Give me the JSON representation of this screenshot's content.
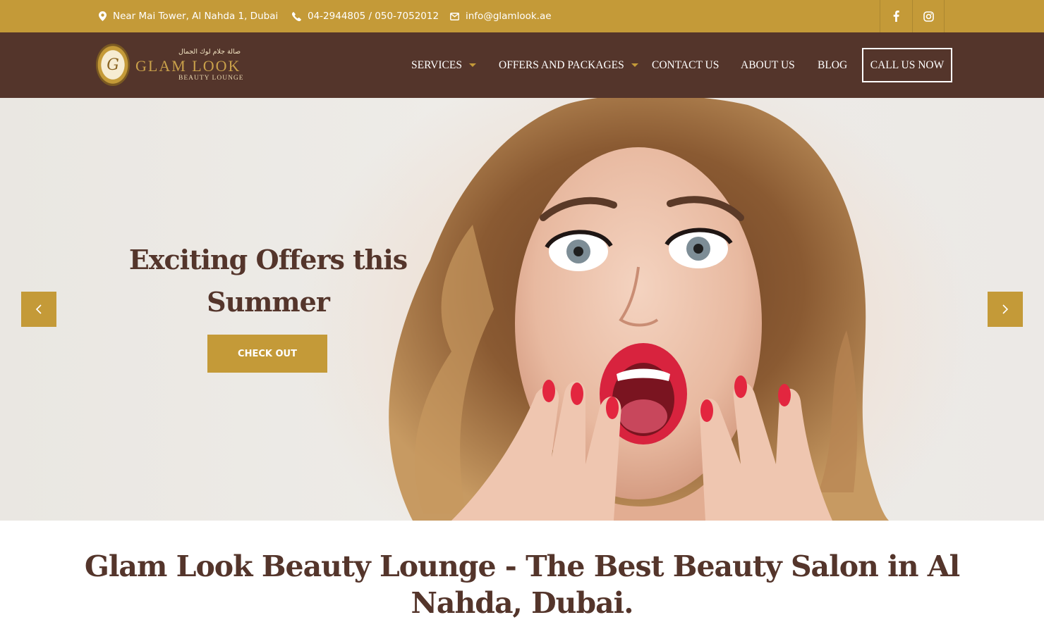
{
  "topbar": {
    "address": "Near Mai Tower, Al Nahda 1, Dubai",
    "phone": "04-2944805 / 050-7052012",
    "email": "info@glamlook.ae",
    "social": [
      "facebook-icon",
      "instagram-icon"
    ]
  },
  "brand": {
    "arabic": "صالة جلام لوك الجمال",
    "name": "GLAM LOOK",
    "tagline": "BEAUTY LOUNGE",
    "monogram": "G"
  },
  "nav": {
    "items": [
      {
        "label": "SERVICES",
        "dropdown": true
      },
      {
        "label": "OFFERS AND PACKAGES",
        "dropdown": true
      },
      {
        "label": "CONTACT US",
        "dropdown": false
      },
      {
        "label": "ABOUT US",
        "dropdown": false
      },
      {
        "label": "BLOG",
        "dropdown": false
      }
    ],
    "cta": "CALL US NOW"
  },
  "hero": {
    "title": "Exciting Offers this Summer",
    "button": "CHECK OUT",
    "prev_icon": "chevron-left-icon",
    "next_icon": "chevron-right-icon"
  },
  "headline": "Glam Look Beauty Lounge - The Best Beauty Salon in Al Nahda, Dubai.",
  "colors": {
    "gold": "#c49a38",
    "brown": "#54352b",
    "white": "#ffffff"
  }
}
